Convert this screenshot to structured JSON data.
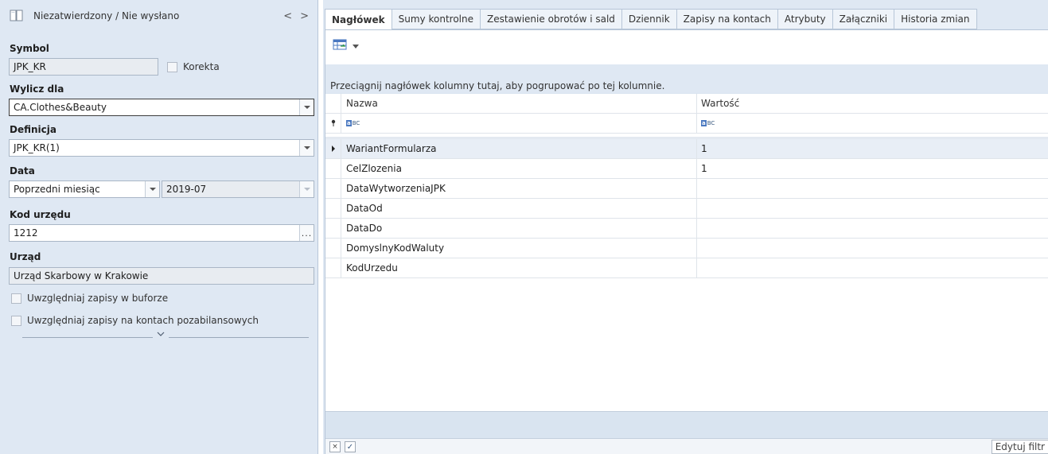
{
  "left_panel": {
    "status": "Niezatwierdzony / Nie wysłano",
    "nav_prev": "<",
    "nav_next": ">",
    "symbol_label": "Symbol",
    "symbol_value": "JPK_KR",
    "korekta_label": "Korekta",
    "wylicz_label": "Wylicz dla",
    "wylicz_value": "CA.Clothes&Beauty",
    "definicja_label": "Definicja",
    "definicja_value": "JPK_KR(1)",
    "data_label": "Data",
    "data_period": "Poprzedni miesiąc",
    "data_value": "2019-07",
    "kod_urzedu_label": "Kod urzędu",
    "kod_urzedu_value": "1212",
    "ellipsis": "...",
    "urzad_label": "Urząd",
    "urzad_value": "Urząd Skarbowy w Krakowie",
    "check_bufor": "Uwzględniaj zapisy w buforze",
    "check_pozabilansowe": "Uwzględniaj zapisy na kontach pozabilansowych"
  },
  "tabs": [
    "Nagłówek",
    "Sumy kontrolne",
    "Zestawienie obrotów i sald",
    "Dziennik",
    "Zapisy na kontach",
    "Atrybuty",
    "Załączniki",
    "Historia zmian"
  ],
  "active_tab": 0,
  "grid": {
    "group_hint": "Przeciągnij nagłówek kolumny tutaj, aby pogrupować po tej kolumnie.",
    "col_name": "Nazwa",
    "col_value": "Wartość",
    "abc_a": "a",
    "abc_bc": "BC",
    "rows": [
      {
        "name": "WariantFormularza",
        "value": "1"
      },
      {
        "name": "CelZlozenia",
        "value": "1"
      },
      {
        "name": "DataWytworzeniaJPK",
        "value": ""
      },
      {
        "name": "DataOd",
        "value": ""
      },
      {
        "name": "DataDo",
        "value": ""
      },
      {
        "name": "DomyslnyKodWaluty",
        "value": ""
      },
      {
        "name": "KodUrzedu",
        "value": ""
      }
    ],
    "edit_filter": "Edytuj filtr",
    "clear_filter": "×",
    "enable_filter": "✓"
  }
}
